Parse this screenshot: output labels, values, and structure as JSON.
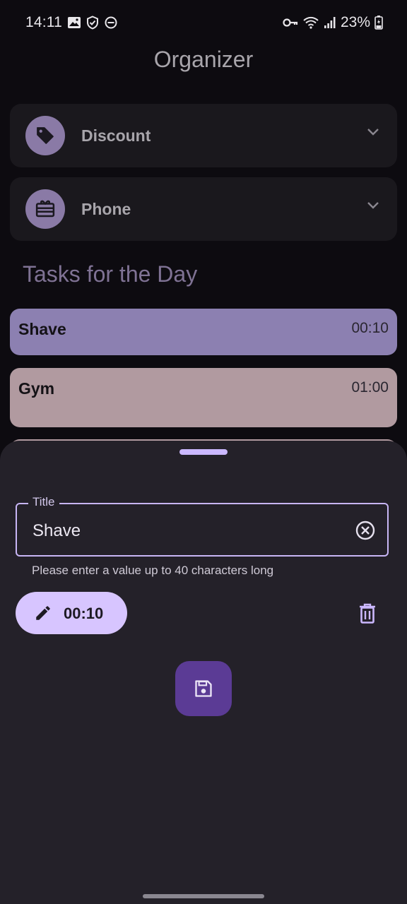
{
  "status_bar": {
    "time": "14:11",
    "battery": "23%",
    "icons": [
      "image-icon",
      "shield-icon",
      "dnd-icon",
      "vpn-key-icon",
      "wifi-icon",
      "signal-icon",
      "battery-icon"
    ]
  },
  "app_bar": {
    "title": "Organizer"
  },
  "categories": [
    {
      "label": "Discount",
      "icon": "tag-icon"
    },
    {
      "label": "Phone",
      "icon": "gift-card-icon"
    }
  ],
  "tasks_section": {
    "title": "Tasks for the Day"
  },
  "tasks": [
    {
      "title": "Shave",
      "time": "00:10",
      "color": "#8c80b1"
    },
    {
      "title": "Gym",
      "time": "01:00",
      "color": "#b19aa0"
    }
  ],
  "sheet": {
    "title_field": {
      "label": "Title",
      "value": "Shave",
      "supporting_text": "Please enter a value up to 40 characters long"
    },
    "time_chip": {
      "label": "00:10",
      "icon": "pencil-icon"
    },
    "delete_icon": "trash-icon",
    "save_icon": "save-icon"
  },
  "colors": {
    "background": "#0d0b10",
    "sheet": "#242129",
    "accent": "#d7c5ff",
    "fab": "#5b3b95",
    "avatar": "#8a7aa6"
  }
}
